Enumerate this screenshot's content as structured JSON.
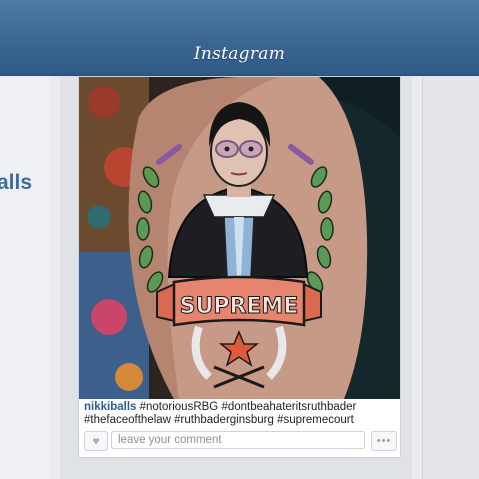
{
  "header": {
    "brand": "Instagram"
  },
  "sidebar": {
    "username_fragment": "alls"
  },
  "post": {
    "image_alt": "Tattoo of Ruth Bader Ginsburg with SUPREME banner",
    "banner_text": "SUPREME",
    "caption": {
      "username": "nikkiballs",
      "text": "#notoriousRBG #dontbeahateritsruthbader #thefaceofthelaw #ruthbaderginsburg #supremecourt"
    },
    "comment": {
      "placeholder": "leave your comment",
      "value": ""
    },
    "actions": {
      "like_icon": "heart-icon",
      "more_icon": "ellipsis-icon"
    }
  }
}
